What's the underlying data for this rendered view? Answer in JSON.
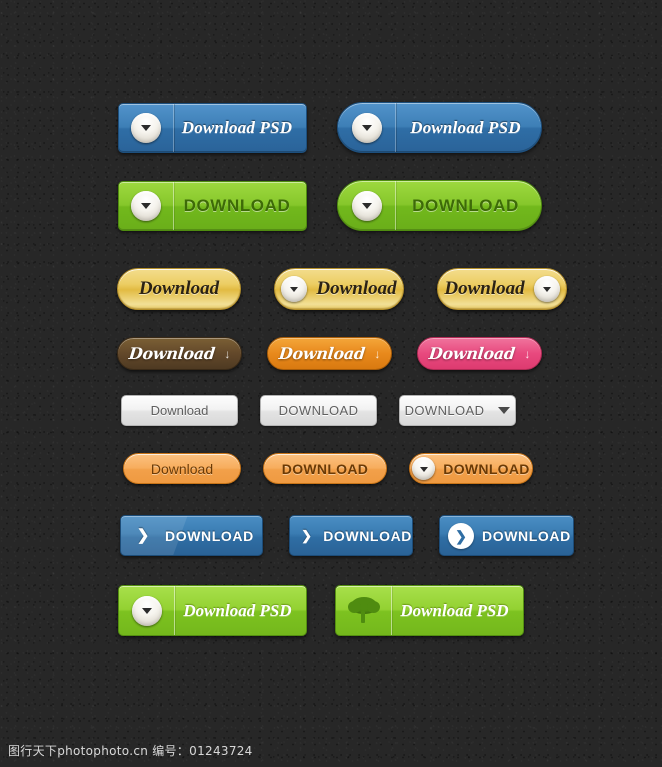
{
  "page": {
    "background_color": "#272727",
    "footer_text": "图行天下photophoto.cn  编号：01243724"
  },
  "rows": {
    "blue_psd": {
      "square": {
        "label": "Download PSD",
        "icon": "chevron-down-circle-icon",
        "color": "#3d7fb6"
      },
      "rounded": {
        "label": "Download PSD",
        "icon": "chevron-down-circle-icon",
        "color": "#3d7fb6"
      }
    },
    "green_download": {
      "square": {
        "label": "DOWNLOAD",
        "icon": "chevron-down-circle-icon",
        "color": "#86c72b"
      },
      "rounded": {
        "label": "DOWNLOAD",
        "icon": "chevron-down-circle-icon",
        "color": "#86c72b"
      }
    },
    "gold": {
      "plain": {
        "label": "Download",
        "color": "#eccd63"
      },
      "icon_left": {
        "label": "Download",
        "icon": "chevron-down-circle-icon",
        "color": "#eccd63"
      },
      "icon_right": {
        "label": "Download",
        "icon": "chevron-down-circle-icon",
        "color": "#eccd63"
      }
    },
    "script": {
      "brown": {
        "label": "Download",
        "arrow": "↓",
        "color": "#63482a"
      },
      "orange": {
        "label": "Download",
        "arrow": "↓",
        "color": "#e8891c"
      },
      "pink": {
        "label": "Download",
        "arrow": "↓",
        "color": "#e8497e"
      }
    },
    "gray": {
      "title_case": {
        "label": "Download",
        "color": "#f2f2f2"
      },
      "upper_case": {
        "label": "DOWNLOAD",
        "color": "#f2f2f2"
      },
      "dropdown": {
        "label": "DOWNLOAD",
        "icon": "triangle-down-icon",
        "color": "#f2f2f2"
      }
    },
    "orange": {
      "title_case": {
        "label": "Download",
        "color": "#f7ad5d"
      },
      "upper_case": {
        "label": "DOWNLOAD",
        "color": "#f7ad5d"
      },
      "with_icon": {
        "label": "DOWNLOAD",
        "icon": "chevron-down-circle-icon",
        "color": "#f7ad5d"
      }
    },
    "blue_arrow": {
      "wide": {
        "label": "DOWNLOAD",
        "icon": "chevron-right-icon",
        "color": "#3a7cb2"
      },
      "medium": {
        "label": "DOWNLOAD",
        "icon": "chevron-right-icon",
        "color": "#3a7cb2"
      },
      "circle": {
        "label": "DOWNLOAD",
        "icon": "chevron-right-circle-icon",
        "color": "#3a7cb2"
      }
    },
    "green_psd": {
      "chevron": {
        "label": "Download PSD",
        "icon": "chevron-down-circle-icon",
        "color": "#93d132"
      },
      "tree": {
        "label": "Download PSD",
        "icon": "tree-icon",
        "color": "#93d132"
      }
    }
  }
}
